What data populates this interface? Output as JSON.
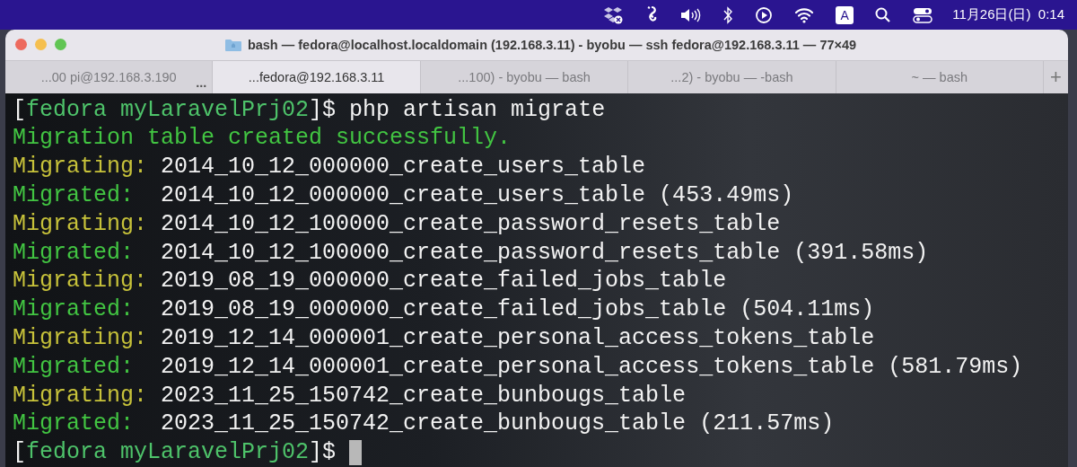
{
  "menu_bar": {
    "clock": "11月26日(日)  0:14",
    "input_source": "A"
  },
  "window": {
    "title": "bash — fedora@localhost.localdomain (192.168.3.11) - byobu — ssh fedora@192.168.3.11 — 77×49"
  },
  "tabs": [
    {
      "label": "...00 pi@192.168.3.190",
      "selected": false,
      "overflow": "..."
    },
    {
      "label": "...fedora@192.168.3.11",
      "selected": true
    },
    {
      "label": "...100) - byobu — bash",
      "selected": false
    },
    {
      "label": "...2) - byobu — -bash",
      "selected": false
    },
    {
      "label": "~ — bash",
      "selected": false
    }
  ],
  "new_tab": "+",
  "terminal": {
    "lines": [
      [
        {
          "kind": "bracket",
          "text": "["
        },
        {
          "kind": "prompt",
          "text": "fedora myLaravelPrj02"
        },
        {
          "kind": "bracket",
          "text": "]$ php artisan migrate"
        }
      ],
      [
        {
          "kind": "success",
          "text": "Migration table created successfully."
        }
      ],
      [
        {
          "kind": "migrating",
          "text": "Migrating: "
        },
        {
          "kind": "plain",
          "text": "2014_10_12_000000_create_users_table"
        }
      ],
      [
        {
          "kind": "migrated",
          "text": "Migrated:  "
        },
        {
          "kind": "plain",
          "text": "2014_10_12_000000_create_users_table (453.49ms)"
        }
      ],
      [
        {
          "kind": "migrating",
          "text": "Migrating: "
        },
        {
          "kind": "plain",
          "text": "2014_10_12_100000_create_password_resets_table"
        }
      ],
      [
        {
          "kind": "migrated",
          "text": "Migrated:  "
        },
        {
          "kind": "plain",
          "text": "2014_10_12_100000_create_password_resets_table (391.58ms)"
        }
      ],
      [
        {
          "kind": "migrating",
          "text": "Migrating: "
        },
        {
          "kind": "plain",
          "text": "2019_08_19_000000_create_failed_jobs_table"
        }
      ],
      [
        {
          "kind": "migrated",
          "text": "Migrated:  "
        },
        {
          "kind": "plain",
          "text": "2019_08_19_000000_create_failed_jobs_table (504.11ms)"
        }
      ],
      [
        {
          "kind": "migrating",
          "text": "Migrating: "
        },
        {
          "kind": "plain",
          "text": "2019_12_14_000001_create_personal_access_tokens_table"
        }
      ],
      [
        {
          "kind": "migrated",
          "text": "Migrated:  "
        },
        {
          "kind": "plain",
          "text": "2019_12_14_000001_create_personal_access_tokens_table (581.79ms)"
        }
      ],
      [
        {
          "kind": "migrating",
          "text": "Migrating: "
        },
        {
          "kind": "plain",
          "text": "2023_11_25_150742_create_bunbougs_table"
        }
      ],
      [
        {
          "kind": "migrated",
          "text": "Migrated:  "
        },
        {
          "kind": "plain",
          "text": "2023_11_25_150742_create_bunbougs_table (211.57ms)"
        }
      ],
      [
        {
          "kind": "bracket",
          "text": "["
        },
        {
          "kind": "prompt",
          "text": "fedora myLaravelPrj02"
        },
        {
          "kind": "bracket",
          "text": "]$ "
        },
        {
          "kind": "cursor"
        }
      ]
    ]
  }
}
